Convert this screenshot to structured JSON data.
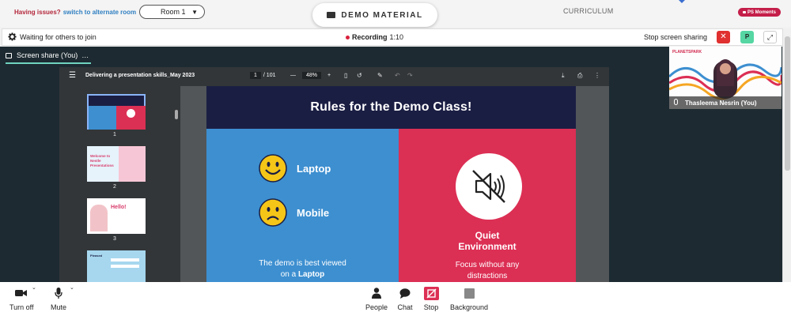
{
  "topbar": {
    "issues_label": "Having issues?",
    "switch_label": "switch to alternate room",
    "room_value": "Room 1",
    "demo_label": "DEMO MATERIAL",
    "curriculum_label": "CURRICULUM",
    "ps_moments_label": "PS Moments"
  },
  "header": {
    "waiting_text": "Waiting for others to join",
    "recording_label": "Recording",
    "recording_time": "1:10",
    "stop_sharing_label": "Stop screen sharing",
    "participant_initial": "P"
  },
  "stage": {
    "tab_label": "Screen share (You)",
    "tab_more": "…"
  },
  "pdf": {
    "title": "Delivering a presentation skills_May 2023",
    "page_current": "1",
    "page_total": "/ 101",
    "zoom": "48%",
    "thumbnails": [
      {
        "num": "1"
      },
      {
        "num": "2",
        "text": "Welcome to Nestle Presentations"
      },
      {
        "num": "3",
        "text": "Hello!"
      },
      {
        "num": "",
        "text": "Pleased"
      }
    ],
    "slide": {
      "title": "Rules for the Demo Class!",
      "option_1": "Laptop",
      "option_2": "Mobile",
      "note_line1": "The demo is best viewed",
      "note_line2_prefix": "on a",
      "note_line2_bold": "Laptop",
      "right_title_1": "Quiet",
      "right_title_2": "Environment",
      "right_sub_1": "Focus without any",
      "right_sub_2": "distractions"
    }
  },
  "video": {
    "name": "Thasleema Nesrin (You)",
    "logo": "PLANETSPARK"
  },
  "controls": {
    "camera_label": "Turn off",
    "mic_label": "Mute",
    "people_label": "People",
    "chat_label": "Chat",
    "stop_label": "Stop",
    "background_label": "Background"
  },
  "colors": {
    "accent_red": "#dc2f54",
    "accent_blue": "#3d8fd0",
    "slide_navy": "#1b1e43",
    "stage_bg": "#1d2a31",
    "tab_underline": "#6fd4c0"
  }
}
